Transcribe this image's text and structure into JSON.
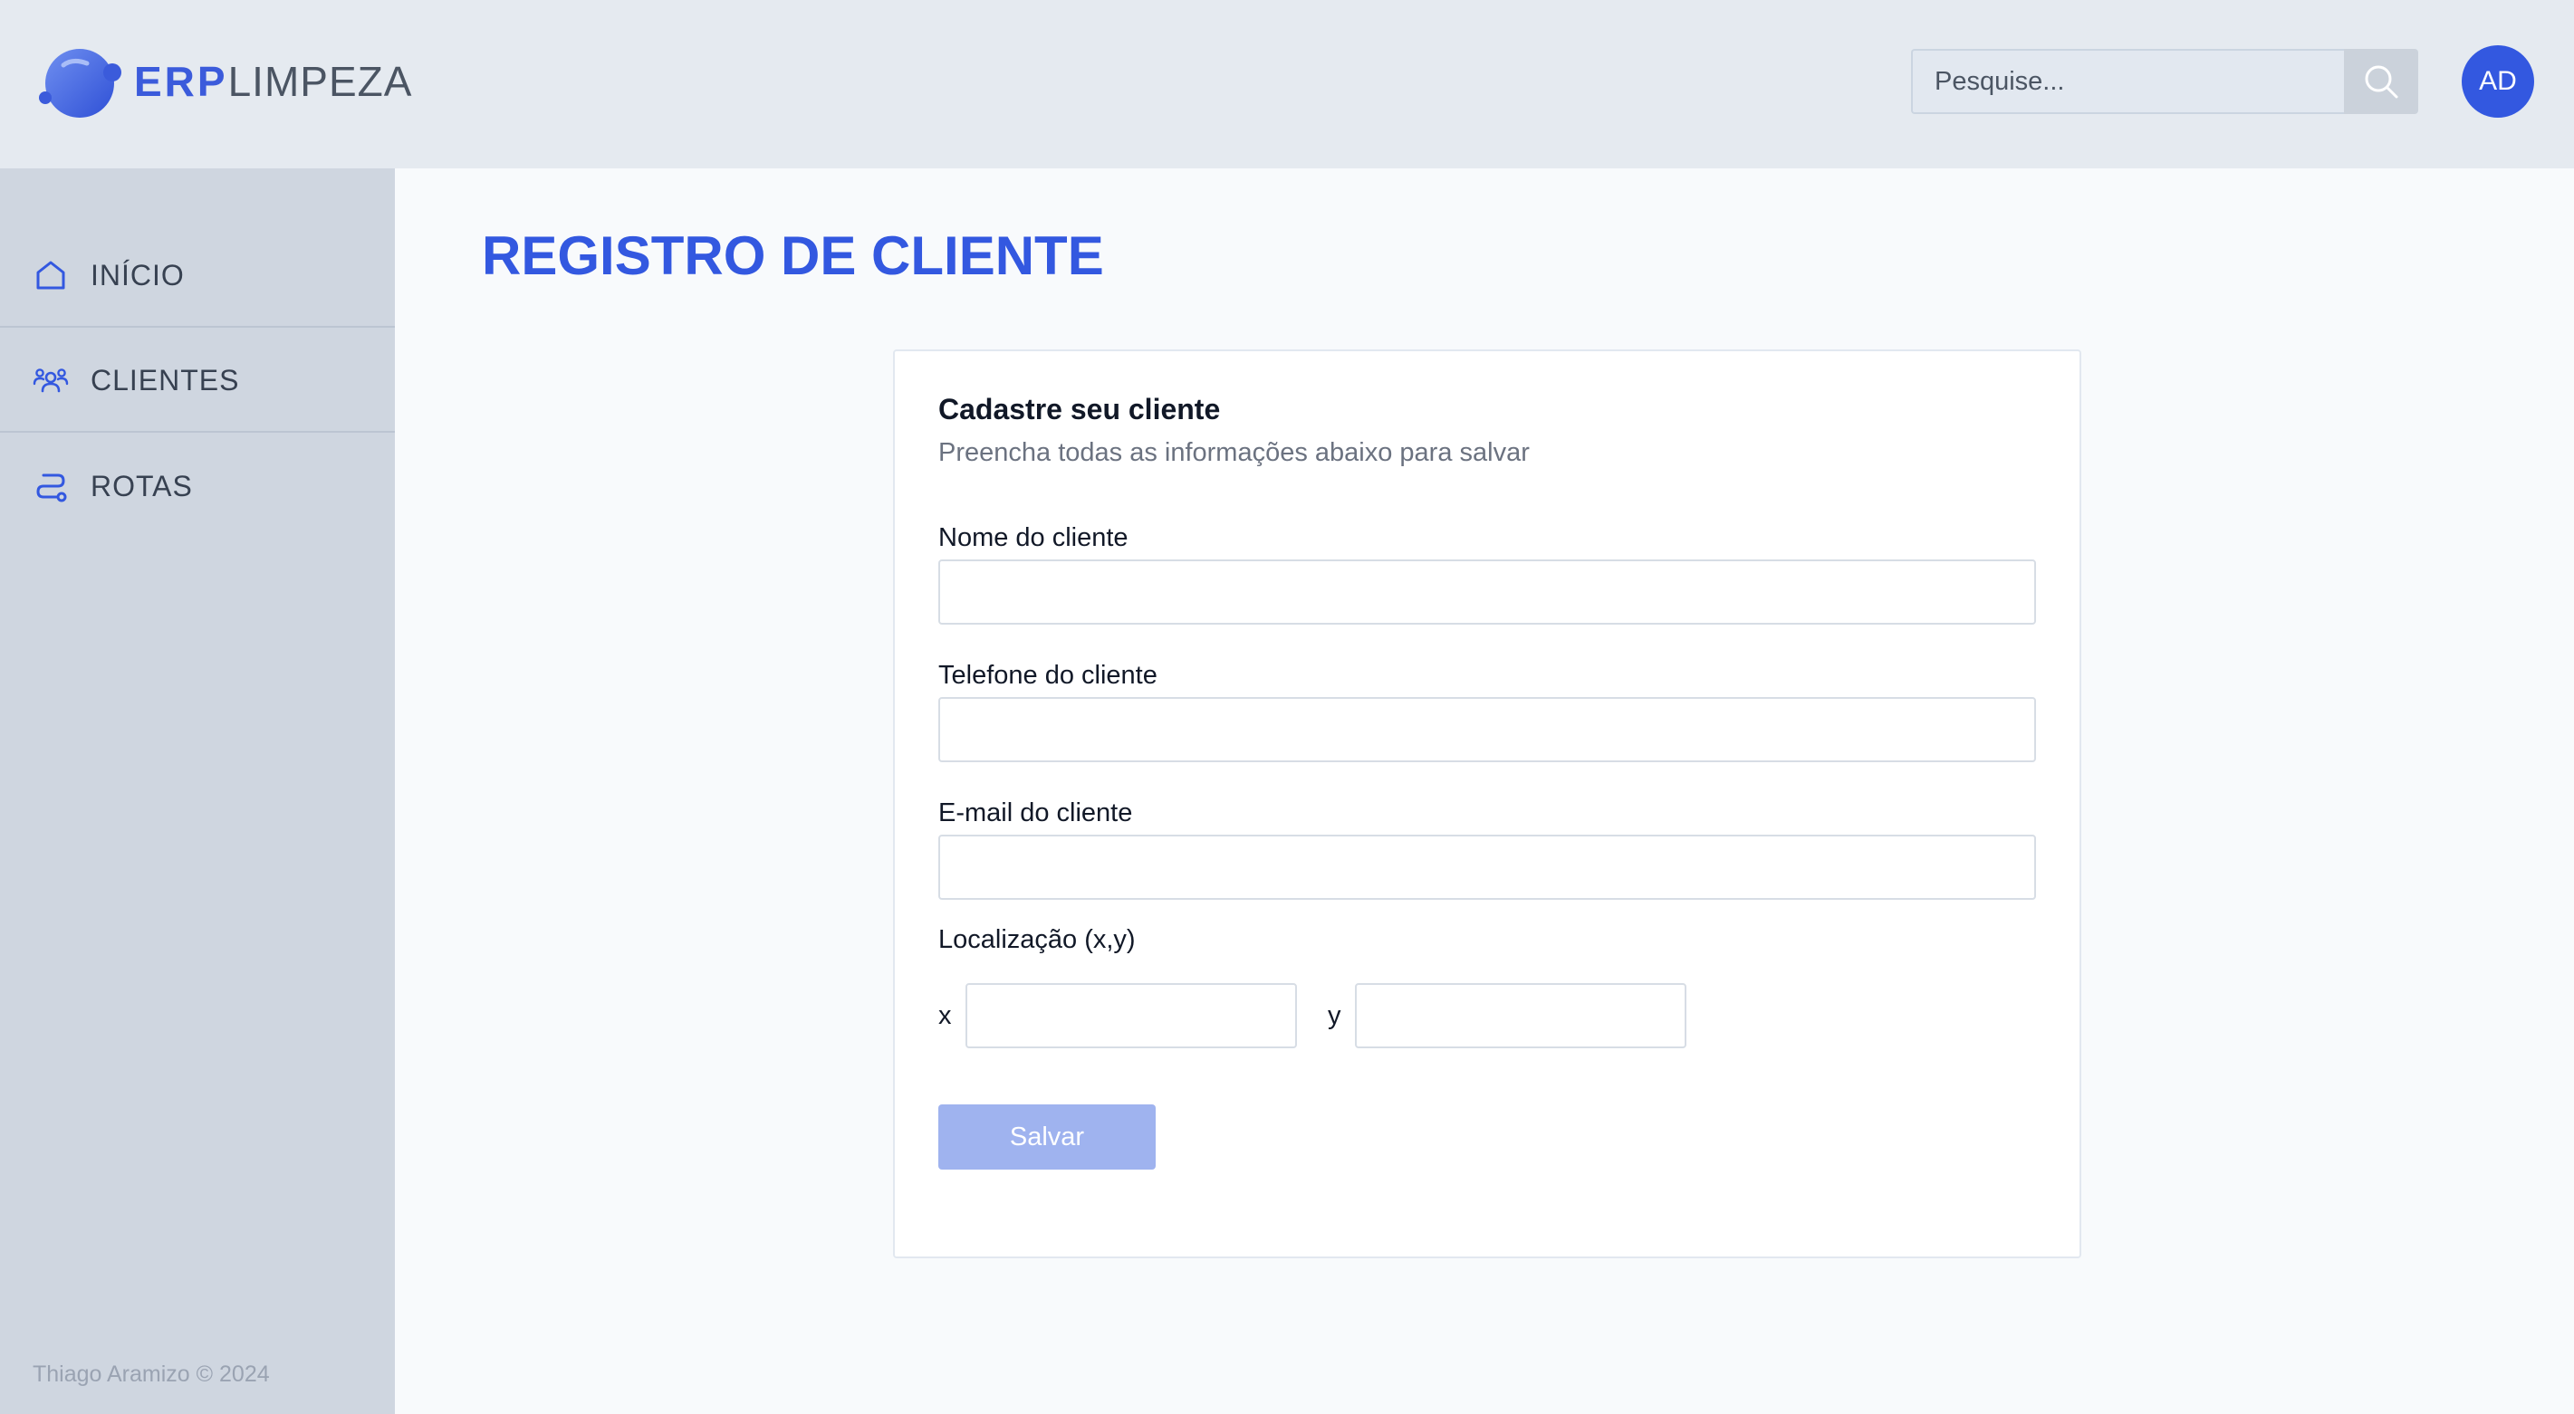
{
  "header": {
    "logo_bold": "ERP",
    "logo_light": "LIMPEZA",
    "search_placeholder": "Pesquise...",
    "avatar_initials": "AD"
  },
  "sidebar": {
    "items": [
      {
        "label": "INÍCIO",
        "icon": "home-icon"
      },
      {
        "label": "CLIENTES",
        "icon": "users-icon"
      },
      {
        "label": "ROTAS",
        "icon": "route-icon"
      }
    ],
    "footer": "Thiago Aramizo © 2024"
  },
  "main": {
    "title": "REGISTRO DE CLIENTE",
    "form": {
      "title": "Cadastre seu cliente",
      "subtitle": "Preencha todas as informações abaixo para salvar",
      "fields": {
        "name_label": "Nome do cliente",
        "name_value": "",
        "phone_label": "Telefone do cliente",
        "phone_value": "",
        "email_label": "E-mail do cliente",
        "email_value": "",
        "location_label": "Localização (x,y)",
        "x_label": "x",
        "x_value": "",
        "y_label": "y",
        "y_value": ""
      },
      "save_label": "Salvar"
    }
  },
  "colors": {
    "accent": "#3358e0",
    "button_disabled": "#9fb3ef",
    "header_bg": "#e5eaf0",
    "sidebar_bg": "#cfd6e0"
  }
}
